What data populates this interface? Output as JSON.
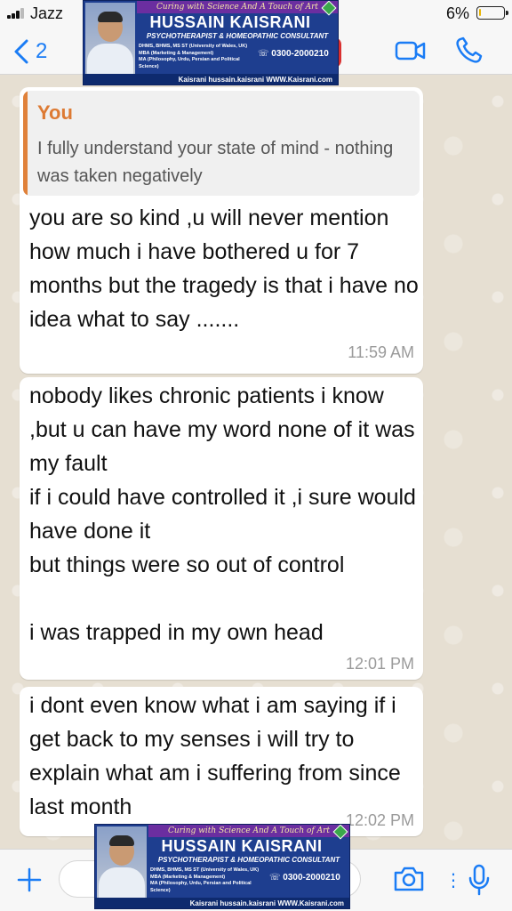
{
  "status_bar": {
    "carrier": "Jazz",
    "battery_percent": "6%",
    "battery_level": 0.06
  },
  "header": {
    "back_count": "2",
    "back_icon": "chevron-left-icon",
    "video_icon": "video-camera-icon",
    "call_icon": "phone-icon"
  },
  "messages": [
    {
      "quote_author": "You",
      "quote_text": "I fully understand your state of mind - nothing was taken negatively",
      "text": "you are so kind ,u will never mention how much i have bothered u for 7 months but the tragedy is that i have no idea what to say .......",
      "time": "11:59 AM"
    },
    {
      "text": "nobody likes chronic patients i know ,but u can have my word none of it was my fault\nif i could have controlled it ,i sure would have done it\nbut things were so out of control\n\ni was trapped in my own head",
      "time": "12:01 PM"
    },
    {
      "text": "i dont even know what i am saying if i get back to my senses i will try to explain what am i suffering from since last month",
      "time": "12:02 PM"
    }
  ],
  "input_bar": {
    "plus_icon": "plus-icon",
    "camera_icon": "camera-icon",
    "more_icon": "more-icon",
    "mic_icon": "microphone-icon"
  },
  "watermark": {
    "tagline": "Curing with Science And A Touch of Art",
    "name": "HUSSAIN KAISRANI",
    "title": "PSYCHOTHERAPIST & HOMEOPATHIC CONSULTANT",
    "qualifications": "DHMS, BHMS, MS ST (University of Wales, UK)\nMBA (Marketing & Management)\nMA (Philosophy, Urdu, Persian and Political Science)",
    "phone": "0300-2000210",
    "links": "Kaisrani  hussain.kaisrani  WWW.Kaisrani.com"
  },
  "colors": {
    "accent": "#1a7cf5",
    "quote_author": "#dd7a33",
    "chat_bg": "#e6dfd2",
    "bubble": "#ffffff",
    "time": "#9a9a9a"
  }
}
